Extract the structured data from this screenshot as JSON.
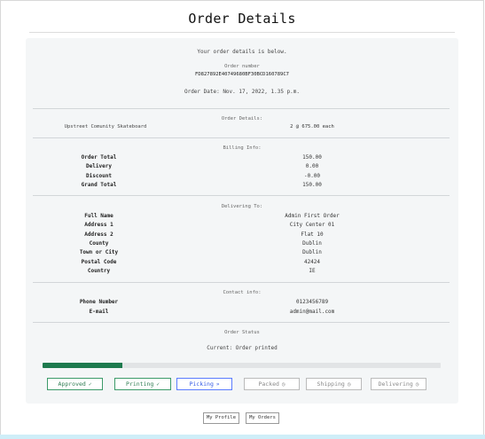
{
  "header": {
    "title": "Order Details"
  },
  "intro": {
    "lead": "Your order details is below.",
    "order_number_label": "Order number",
    "order_number": "FD827892E40749680BF30BCD160789C7",
    "order_date": "Order Date: Nov. 17, 2022, 1.35 p.m."
  },
  "order_details": {
    "label": "Order Details:",
    "item_name": "Upstreet Comunity Skateboard",
    "item_qty_price": "2 @ 675.00 each"
  },
  "billing": {
    "label": "Billing Info:",
    "rows": [
      {
        "k": "Order Total",
        "v": "150.00"
      },
      {
        "k": "Delivery",
        "v": "0.00"
      },
      {
        "k": "Discount",
        "v": "-0.00"
      },
      {
        "k": "Grand Total",
        "v": "150.00"
      }
    ]
  },
  "delivering": {
    "label": "Delivering To:",
    "rows": [
      {
        "k": "Full Name",
        "v": "Admin First Order"
      },
      {
        "k": "Address 1",
        "v": "City Center 01"
      },
      {
        "k": "Address 2",
        "v": "Flat 10"
      },
      {
        "k": "County",
        "v": "Dublin"
      },
      {
        "k": "Town or City",
        "v": "Dublin"
      },
      {
        "k": "Postal Code",
        "v": "42424"
      },
      {
        "k": "Country",
        "v": "IE"
      }
    ]
  },
  "contact": {
    "label": "Contact info:",
    "rows": [
      {
        "k": "Phone Number",
        "v": "0123456789"
      },
      {
        "k": "E-mail",
        "v": "admin@mail.com"
      }
    ]
  },
  "status": {
    "label": "Order Status",
    "current": "Current: Order printed",
    "progress_fraction": 0.2,
    "colors": {
      "done": "#2e7d52",
      "current": "#3459e6",
      "pending": "#888888",
      "bar": "#1e7a4e"
    },
    "steps": [
      {
        "label": "Approved",
        "icon": "✓",
        "icon_name": "check-icon",
        "state": "done"
      },
      {
        "label": "Printing",
        "icon": "✓",
        "icon_name": "check-icon",
        "state": "done"
      },
      {
        "label": "Picking",
        "icon": "»",
        "icon_name": "double-chevron-right-icon",
        "state": "current"
      },
      {
        "label": "Packed",
        "icon": "◷",
        "icon_name": "clock-icon",
        "state": "pending"
      },
      {
        "label": "Shipping",
        "icon": "◷",
        "icon_name": "clock-icon",
        "state": "pending"
      },
      {
        "label": "Delivering",
        "icon": "◷",
        "icon_name": "clock-icon",
        "state": "pending"
      }
    ]
  },
  "footer": {
    "my_profile": "My Profile",
    "my_orders": "My Orders"
  }
}
